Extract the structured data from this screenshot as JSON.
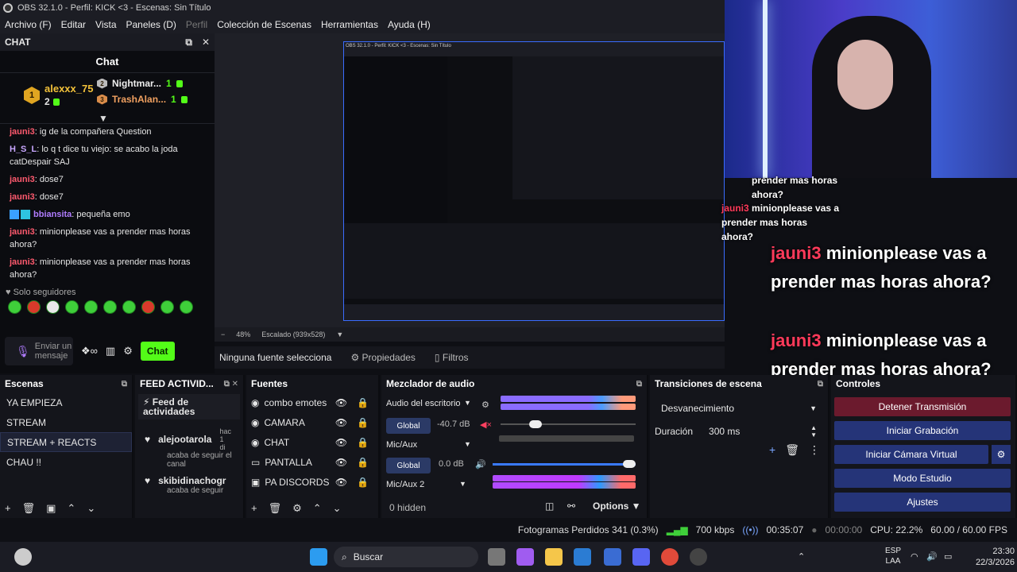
{
  "window": {
    "title": "OBS 32.1.0 - Perfil: KICK <3 - Escenas: Sin Título"
  },
  "menu": [
    {
      "label": "Archivo (F)",
      "disabled": false
    },
    {
      "label": "Editar",
      "disabled": false
    },
    {
      "label": "Vista",
      "disabled": false
    },
    {
      "label": "Paneles (D)",
      "disabled": false
    },
    {
      "label": "Perfil",
      "disabled": true
    },
    {
      "label": "Colección de Escenas",
      "disabled": false
    },
    {
      "label": "Herramientas",
      "disabled": false
    },
    {
      "label": "Ayuda (H)",
      "disabled": false
    }
  ],
  "chat_dock": {
    "header": "CHAT",
    "title": "Chat",
    "leaders": [
      {
        "rank": "1",
        "name": "alexxx_75",
        "count": "2"
      },
      {
        "rank": "2",
        "name": "Nightmar...",
        "count": "1"
      },
      {
        "rank": "3",
        "name": "TrashAlan...",
        "count": "1"
      }
    ],
    "messages": [
      {
        "user": "jauni3",
        "text": ": ig de la compañera Question"
      },
      {
        "user": "H_S_L",
        "text": ": lo q t dice tu viejo: se acabo la joda catDespair SAJ"
      },
      {
        "user": "jauni3",
        "text": ": dose7"
      },
      {
        "user": "jauni3",
        "text": ": dose7"
      },
      {
        "user": "bbiansita",
        "text": ": pequeña emo"
      },
      {
        "user": "jauni3",
        "text": ": minionplease vas a prender mas horas ahora?"
      },
      {
        "user": "jauni3",
        "text": ": minionplease vas a prender mas horas ahora?"
      }
    ],
    "followers_label": "Solo seguidores",
    "input_placeholder": "Enviar un mensaje",
    "send_label": "Chat"
  },
  "preview": {
    "zoom": "48%",
    "scaling": "Escalado (939x528)",
    "no_source": "Ninguna fuente selecciona",
    "properties": "Propiedades",
    "filters": "Filtros"
  },
  "overlay": {
    "small": [
      {
        "nick": "",
        "text": "prender mas horas ahora?"
      },
      {
        "nick": "jauni3",
        "text": "minionplease vas a prender mas horas ahora?"
      }
    ],
    "large": [
      {
        "nick": "jauni3",
        "text": "minionplease vas a prender mas horas ahora?"
      },
      {
        "nick": "jauni3",
        "text": "minionplease vas a prender mas horas ahora?"
      }
    ]
  },
  "scenes": {
    "title": "Escenas",
    "items": [
      "YA EMPIEZA",
      "STREAM",
      "STREAM + REACTS",
      "CHAU !!"
    ],
    "selected": 2
  },
  "feed": {
    "title": "FEED ACTIVID...",
    "header": "Feed de actividades",
    "items": [
      {
        "name": "alejootarola",
        "time": "hac 1 di",
        "text": "acaba de seguir el canal"
      },
      {
        "name": "skibidinachogr",
        "time": "",
        "text": "acaba de seguir"
      }
    ]
  },
  "sources": {
    "title": "Fuentes",
    "items": [
      "combo emotes",
      "CAMARA",
      "CHAT",
      "PANTALLA",
      "PA DISCORDS"
    ]
  },
  "mixer": {
    "title": "Mezclador de audio",
    "channels": [
      {
        "name": "Audio del escritorio",
        "db": "-40.7 dB",
        "level": 0.12
      },
      {
        "name": "Mic/Aux",
        "db": "0.0 dB",
        "level": 0.95
      },
      {
        "name": "Mic/Aux 2",
        "db": "",
        "level": 0.6
      }
    ],
    "global": "Global",
    "ticks": [
      "-60",
      "-54",
      "-48",
      "-42",
      "-36",
      "-30",
      "-24",
      "-18",
      "-12",
      "-6",
      "0"
    ],
    "hidden": "0 hidden",
    "options": "Options"
  },
  "transitions": {
    "title": "Transiciones de escena",
    "selected": "Desvanecimiento",
    "duration_label": "Duración",
    "duration": "300 ms"
  },
  "controls": {
    "title": "Controles",
    "buttons": [
      "Detener Transmisión",
      "Iniciar Grabación",
      "Iniciar Cámara Virtual",
      "Modo Estudio",
      "Ajustes"
    ]
  },
  "status": {
    "dropped": "Fotogramas Perdidos 341 (0.3%)",
    "kbps": "700 kbps",
    "stream_time": "00:35:07",
    "rec_time": "00:00:00",
    "cpu": "CPU: 22.2%",
    "fps": "60.00 / 60.00 FPS"
  },
  "taskbar": {
    "search": "Buscar",
    "lang": "ESP",
    "lang2": "LAA",
    "time": "23:30",
    "date": "22/3/2026"
  },
  "colors": {
    "accent": "#53fc18",
    "blue_button": "#253478",
    "red_button": "#6b1a2d",
    "user_red": "#ff5a6e"
  }
}
